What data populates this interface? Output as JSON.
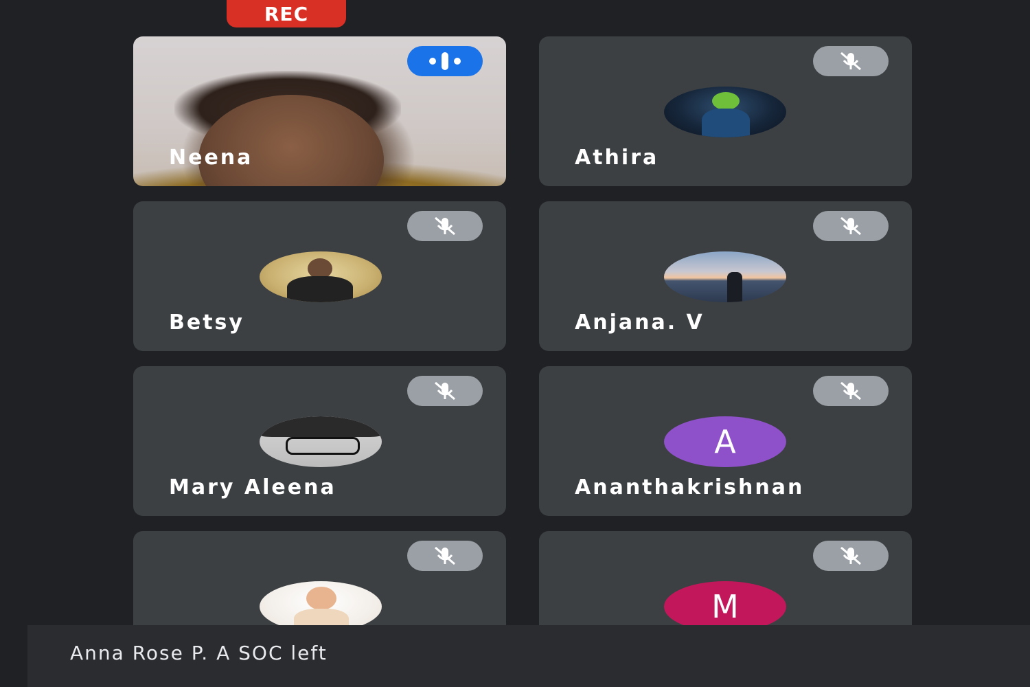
{
  "recording_badge": "REC",
  "participants": [
    {
      "name": "Neena",
      "status": "speaking"
    },
    {
      "name": "Athira",
      "status": "muted"
    },
    {
      "name": "Betsy",
      "status": "muted"
    },
    {
      "name": "Anjana. V",
      "status": "muted"
    },
    {
      "name": "Mary Aleena",
      "status": "muted"
    },
    {
      "name": "Ananthakrishnan",
      "status": "muted",
      "avatar_letter": "A",
      "avatar_color": "#8e51c9"
    },
    {
      "name": "",
      "status": "muted"
    },
    {
      "name": "",
      "status": "muted",
      "avatar_letter": "M",
      "avatar_color": "#c2185b"
    }
  ],
  "icons": {
    "muted": "mic-off-icon",
    "speaking": "audio-level-icon"
  },
  "notification": {
    "text": "Anna Rose P. A SOC left"
  },
  "colors": {
    "background": "#202124",
    "tile": "#3c4043",
    "rec": "#d93025",
    "speaking": "#1a73e8",
    "muted_pill": "#9aa0a6"
  }
}
